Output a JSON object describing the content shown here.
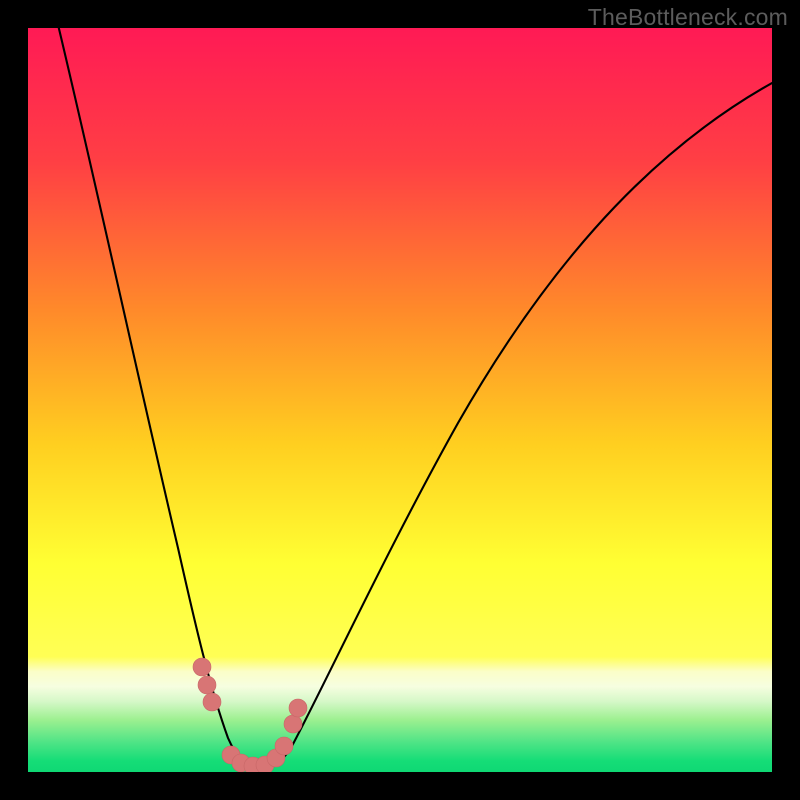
{
  "watermark": "TheBottleneck.com",
  "colors": {
    "frame": "#000000",
    "grad_top": "#ff1a55",
    "grad_mid1": "#ff6a2b",
    "grad_mid2": "#ffd21f",
    "grad_mid3": "#ffff33",
    "grad_pale": "#fafee0",
    "grad_green1": "#9cf090",
    "grad_green2": "#15dd77",
    "curve": "#000000",
    "markers": "#d87575"
  },
  "chart_data": {
    "type": "line",
    "title": "",
    "xlabel": "",
    "ylabel": "",
    "xlim": [
      0,
      100
    ],
    "ylim": [
      0,
      100
    ],
    "note": "V-shaped bottleneck curve; minimum near x≈30 where value≈0. Values estimated from pixel heights on a 0–100 scale.",
    "series": [
      {
        "name": "bottleneck-curve",
        "x": [
          0,
          5,
          10,
          14,
          18,
          20,
          22,
          24,
          26,
          28,
          30,
          32,
          34,
          36,
          38,
          40,
          45,
          50,
          55,
          60,
          65,
          70,
          75,
          80,
          85,
          90,
          95,
          100
        ],
        "values": [
          100,
          90,
          77,
          65,
          50,
          40,
          30,
          18,
          8,
          2,
          0,
          1,
          3,
          6,
          10,
          15,
          26,
          36,
          45,
          53,
          60,
          66,
          71,
          76,
          80,
          84,
          87,
          90
        ]
      }
    ],
    "markers": {
      "name": "highlight-dots",
      "x": [
        23.0,
        23.6,
        24.2,
        27.0,
        28.5,
        30.0,
        31.5,
        33.0,
        34.0,
        34.8,
        35.4
      ],
      "values": [
        14.0,
        11.5,
        9.2,
        1.2,
        0.6,
        0.4,
        0.6,
        1.4,
        3.0,
        5.5,
        8.0
      ]
    }
  }
}
